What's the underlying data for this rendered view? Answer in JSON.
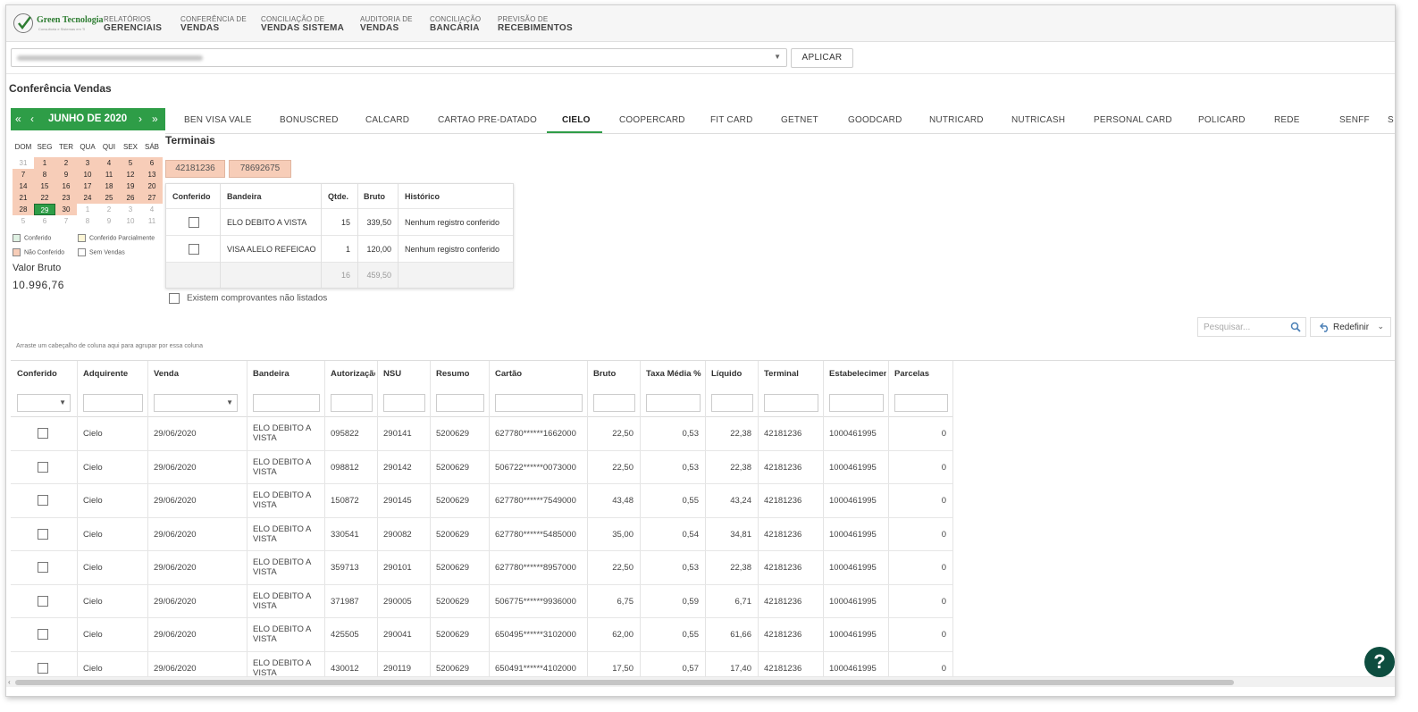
{
  "brand": {
    "name": "Green Tecnologia",
    "tagline": "Consultoria e Sistemas em TI"
  },
  "nav": [
    {
      "l1": "RELATÓRIOS",
      "l2": "GERENCIAIS"
    },
    {
      "l1": "CONFERÊNCIA DE",
      "l2": "VENDAS"
    },
    {
      "l1": "CONCILIAÇÃO DE",
      "l2": "VENDAS SISTEMA"
    },
    {
      "l1": "AUDITORIA DE",
      "l2": "VENDAS"
    },
    {
      "l1": "CONCILIAÇÃO",
      "l2": "BANCÁRIA"
    },
    {
      "l1": "PREVISÃO DE",
      "l2": "RECEBIMENTOS"
    }
  ],
  "filter": {
    "apply_label": "APLICAR"
  },
  "page_title": "Conferência Vendas",
  "calendar": {
    "title": "JUNHO DE 2020",
    "dow": [
      "DOM",
      "SEG",
      "TER",
      "QUA",
      "QUI",
      "SEX",
      "SÁB"
    ],
    "weeks": [
      [
        "31",
        "1",
        "2",
        "3",
        "4",
        "5",
        "6"
      ],
      [
        "7",
        "8",
        "9",
        "10",
        "11",
        "12",
        "13"
      ],
      [
        "14",
        "15",
        "16",
        "17",
        "18",
        "19",
        "20"
      ],
      [
        "21",
        "22",
        "23",
        "24",
        "25",
        "26",
        "27"
      ],
      [
        "28",
        "29",
        "30",
        "1",
        "2",
        "3",
        "4"
      ],
      [
        "5",
        "6",
        "7",
        "8",
        "9",
        "10",
        "11"
      ]
    ],
    "selected_day": "29"
  },
  "legend": {
    "conferido": "Conferido",
    "parcial": "Conferido Parcialmente",
    "nao_conferido": "Não Conferido",
    "sem_vendas": "Sem Vendas"
  },
  "colors": {
    "accent": "#2e9d47",
    "nao_conferido": "#f7cdb8",
    "help": "#0d4d3f"
  },
  "valor_bruto": {
    "label": "Valor Bruto",
    "value": "10.996,76"
  },
  "tabs": [
    "BEN VISA VALE",
    "BONUSCRED",
    "CALCARD",
    "CARTAO PRE-DATADO",
    "CIELO",
    "COOPERCARD",
    "FIT CARD",
    "GETNET",
    "GOODCARD",
    "NUTRICARD",
    "NUTRICASH",
    "PERSONAL CARD",
    "POLICARD",
    "REDE",
    "SENFF",
    "S"
  ],
  "active_tab": "CIELO",
  "terminais": {
    "title": "Terminais",
    "chips": [
      "42181236",
      "78692675"
    ]
  },
  "summary": {
    "headers": [
      "Conferido",
      "Bandeira",
      "Qtde.",
      "Bruto",
      "Histórico"
    ],
    "rows": [
      {
        "bandeira": "ELO DEBITO A VISTA",
        "qtde": "15",
        "bruto": "339,50",
        "historico": "Nenhum registro conferido"
      },
      {
        "bandeira": "VISA ALELO REFEICAO",
        "qtde": "1",
        "bruto": "120,00",
        "historico": "Nenhum registro conferido"
      }
    ],
    "total": {
      "qtde": "16",
      "bruto": "459,50"
    }
  },
  "nao_listados_label": "Existem comprovantes não listados",
  "search": {
    "placeholder": "Pesquisar..."
  },
  "redefinir_label": "Redefinir",
  "group_hint": "Arraste um cabeçalho de coluna aqui para agrupar por essa coluna",
  "grid": {
    "headers": [
      "Conferido",
      "Adquirente",
      "Venda",
      "Bandeira",
      "Autorização",
      "NSU",
      "Resumo",
      "Cartão",
      "Bruto",
      "Taxa Média %",
      "Líquido",
      "Terminal",
      "Estabelecimento",
      "Parcelas"
    ],
    "rows": [
      {
        "adquirente": "Cielo",
        "venda": "29/06/2020",
        "bandeira": "ELO DEBITO A VISTA",
        "autorizacao": "095822",
        "nsu": "290141",
        "resumo": "5200629",
        "cartao": "627780******1662000",
        "bruto": "22,50",
        "taxa": "0,53",
        "liquido": "22,38",
        "terminal": "42181236",
        "estabelecimento": "1000461995",
        "parcelas": "0"
      },
      {
        "adquirente": "Cielo",
        "venda": "29/06/2020",
        "bandeira": "ELO DEBITO A VISTA",
        "autorizacao": "098812",
        "nsu": "290142",
        "resumo": "5200629",
        "cartao": "506722******0073000",
        "bruto": "22,50",
        "taxa": "0,53",
        "liquido": "22,38",
        "terminal": "42181236",
        "estabelecimento": "1000461995",
        "parcelas": "0"
      },
      {
        "adquirente": "Cielo",
        "venda": "29/06/2020",
        "bandeira": "ELO DEBITO A VISTA",
        "autorizacao": "150872",
        "nsu": "290145",
        "resumo": "5200629",
        "cartao": "627780******7549000",
        "bruto": "43,48",
        "taxa": "0,55",
        "liquido": "43,24",
        "terminal": "42181236",
        "estabelecimento": "1000461995",
        "parcelas": "0"
      },
      {
        "adquirente": "Cielo",
        "venda": "29/06/2020",
        "bandeira": "ELO DEBITO A VISTA",
        "autorizacao": "330541",
        "nsu": "290082",
        "resumo": "5200629",
        "cartao": "627780******5485000",
        "bruto": "35,00",
        "taxa": "0,54",
        "liquido": "34,81",
        "terminal": "42181236",
        "estabelecimento": "1000461995",
        "parcelas": "0"
      },
      {
        "adquirente": "Cielo",
        "venda": "29/06/2020",
        "bandeira": "ELO DEBITO A VISTA",
        "autorizacao": "359713",
        "nsu": "290101",
        "resumo": "5200629",
        "cartao": "627780******8957000",
        "bruto": "22,50",
        "taxa": "0,53",
        "liquido": "22,38",
        "terminal": "42181236",
        "estabelecimento": "1000461995",
        "parcelas": "0"
      },
      {
        "adquirente": "Cielo",
        "venda": "29/06/2020",
        "bandeira": "ELO DEBITO A VISTA",
        "autorizacao": "371987",
        "nsu": "290005",
        "resumo": "5200629",
        "cartao": "506775******9936000",
        "bruto": "6,75",
        "taxa": "0,59",
        "liquido": "6,71",
        "terminal": "42181236",
        "estabelecimento": "1000461995",
        "parcelas": "0"
      },
      {
        "adquirente": "Cielo",
        "venda": "29/06/2020",
        "bandeira": "ELO DEBITO A VISTA",
        "autorizacao": "425505",
        "nsu": "290041",
        "resumo": "5200629",
        "cartao": "650495******3102000",
        "bruto": "62,00",
        "taxa": "0,55",
        "liquido": "61,66",
        "terminal": "42181236",
        "estabelecimento": "1000461995",
        "parcelas": "0"
      },
      {
        "adquirente": "Cielo",
        "venda": "29/06/2020",
        "bandeira": "ELO DEBITO A VISTA",
        "autorizacao": "430012",
        "nsu": "290119",
        "resumo": "5200629",
        "cartao": "650491******4102000",
        "bruto": "17,50",
        "taxa": "0,57",
        "liquido": "17,40",
        "terminal": "42181236",
        "estabelecimento": "1000461995",
        "parcelas": "0"
      }
    ]
  },
  "help_label": "?"
}
